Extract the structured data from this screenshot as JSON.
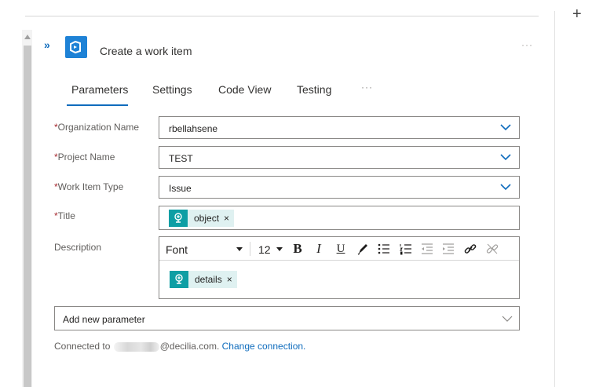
{
  "toolbar": {
    "add_icon": "+"
  },
  "action": {
    "expand_icon": "»",
    "icon": "azure-devops-icon",
    "title": "Create a work item",
    "more": "···"
  },
  "tabs": [
    {
      "label": "Parameters",
      "active": true
    },
    {
      "label": "Settings"
    },
    {
      "label": "Code View"
    },
    {
      "label": "Testing"
    }
  ],
  "tabs_more": "···",
  "fields": {
    "organization": {
      "required_mark": "*",
      "label": "Organization Name",
      "value": "rbellahsene"
    },
    "project": {
      "required_mark": "*",
      "label": "Project Name",
      "value": "TEST"
    },
    "work_item_type": {
      "required_mark": "*",
      "label": "Work Item Type",
      "value": "Issue"
    },
    "title": {
      "required_mark": "*",
      "label": "Title",
      "token": "object",
      "token_remove": "×"
    },
    "description": {
      "label": "Description",
      "token": "details",
      "token_remove": "×"
    }
  },
  "editor": {
    "font": "Font",
    "size": "12",
    "bold": "B",
    "italic": "I",
    "underline": "U"
  },
  "add_parameter": {
    "placeholder": "Add new parameter"
  },
  "connection": {
    "prefix": "Connected to",
    "domain": "@decilia.com.",
    "change_link": "Change connection."
  },
  "colors": {
    "accent": "#0f6cbd",
    "token_icon": "#0e9ea4",
    "token_bg": "#dff1f1",
    "app_icon": "#1e82d6",
    "required": "#a4262c"
  }
}
